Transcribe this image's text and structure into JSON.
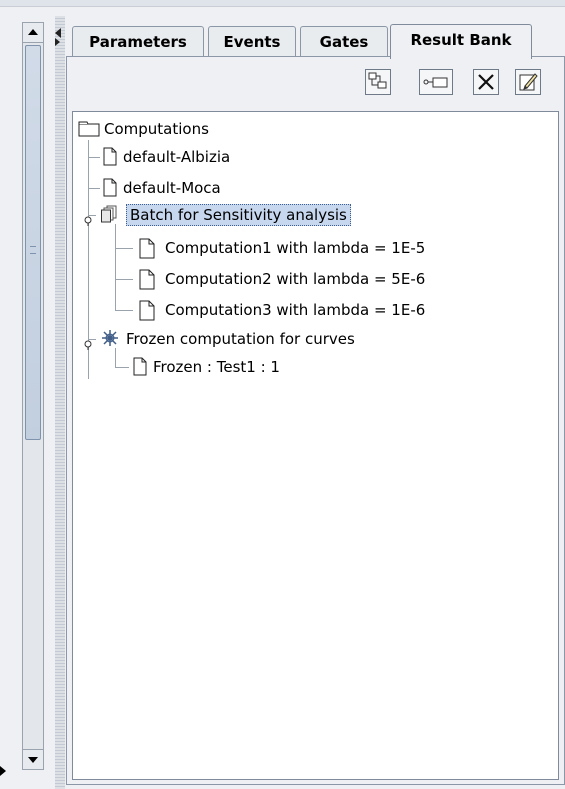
{
  "tabs": [
    {
      "label": "Parameters",
      "active": false
    },
    {
      "label": "Events",
      "active": false
    },
    {
      "label": "Gates",
      "active": false
    },
    {
      "label": "Result Bank",
      "active": true
    }
  ],
  "toolbar": {
    "buttons": [
      {
        "icon": "tree-expand-icon"
      },
      {
        "icon": "rename-link-icon"
      },
      {
        "icon": "delete-icon"
      },
      {
        "icon": "edit-note-icon"
      }
    ]
  },
  "tree": {
    "root": {
      "label": "Computations",
      "icon": "folder-icon"
    },
    "items": [
      {
        "label": "default-Albizia",
        "icon": "document-icon",
        "level": 1
      },
      {
        "label": "default-Moca",
        "icon": "document-icon",
        "level": 1
      },
      {
        "label": "Batch for Sensitivity analysis",
        "icon": "batch-icon",
        "level": 1,
        "selected": true,
        "expanded": true
      },
      {
        "label": "Computation1 with lambda = 1E-5",
        "icon": "document-icon",
        "level": 2
      },
      {
        "label": "Computation2 with lambda = 5E-6",
        "icon": "document-icon",
        "level": 2
      },
      {
        "label": "Computation3 with lambda = 1E-6",
        "icon": "document-icon",
        "level": 2
      },
      {
        "label": "Frozen computation for curves",
        "icon": "frozen-icon",
        "level": 1,
        "expanded": true
      },
      {
        "label": "Frozen : Test1 : 1",
        "icon": "document-icon",
        "level": 2
      }
    ]
  },
  "colors": {
    "selection": "#c6d7ee",
    "panel": "#eef0f3",
    "scroll_thumb": "#c2cfdf"
  }
}
